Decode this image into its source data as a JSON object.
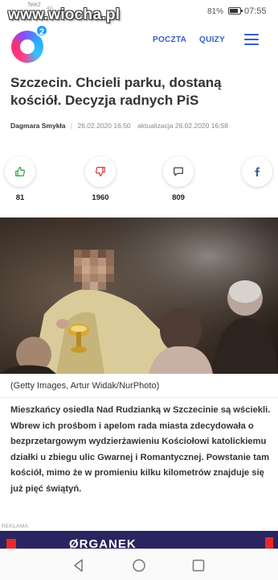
{
  "status_bar": {
    "carrier": "Tele2",
    "carrier_sub": "4G",
    "battery_percent": "81%",
    "battery_level": 0.81,
    "time": "07:55"
  },
  "watermark": "www.wiocha.pl",
  "header": {
    "logo_superscript": "2",
    "nav": [
      {
        "label": "POCZTA"
      },
      {
        "label": "QUIZY"
      }
    ],
    "menu_icon": "hamburger-icon",
    "accent_color": "#3560c4"
  },
  "article": {
    "title": "Szczecin. Chcieli parku, dostaną kościół. Decyzja radnych PiS",
    "author": "Dagmara Smykła",
    "published": "26.02.2020 16:50",
    "updated_label": "aktualizacja",
    "updated": "26.02.2020 16:58",
    "reactions": [
      {
        "icon": "thumbs-up-icon",
        "count": "81",
        "color": "#2e9e3a"
      },
      {
        "icon": "thumbs-down-icon",
        "count": "1960",
        "color": "#d93030"
      },
      {
        "icon": "comment-icon",
        "count": "809",
        "color": "#333333"
      },
      {
        "icon": "facebook-icon",
        "count": "",
        "color": "#3b5998"
      }
    ],
    "photo_caption": "(Getty Images, Artur Widak/NurPhoto)",
    "lead": "Mieszkańcy osiedla Nad Rudzianką w Szczecinie są wściekli. Wbrew ich prośbom i apelom rada miasta zdecydowała o bezprzetargowym wydzierżawieniu Kościołowi katolickiemu działki u zbiegu ulic Gwarnej i Romantycznej. Powstanie tam kościół, mimo że w promieniu kilku kilometrów znajduje się już pięć świątyń."
  },
  "ad": {
    "label": "REKLAMA",
    "brand": "ØRGANEK"
  },
  "navbar": {
    "items": [
      "back-icon",
      "home-icon",
      "recents-icon"
    ]
  }
}
